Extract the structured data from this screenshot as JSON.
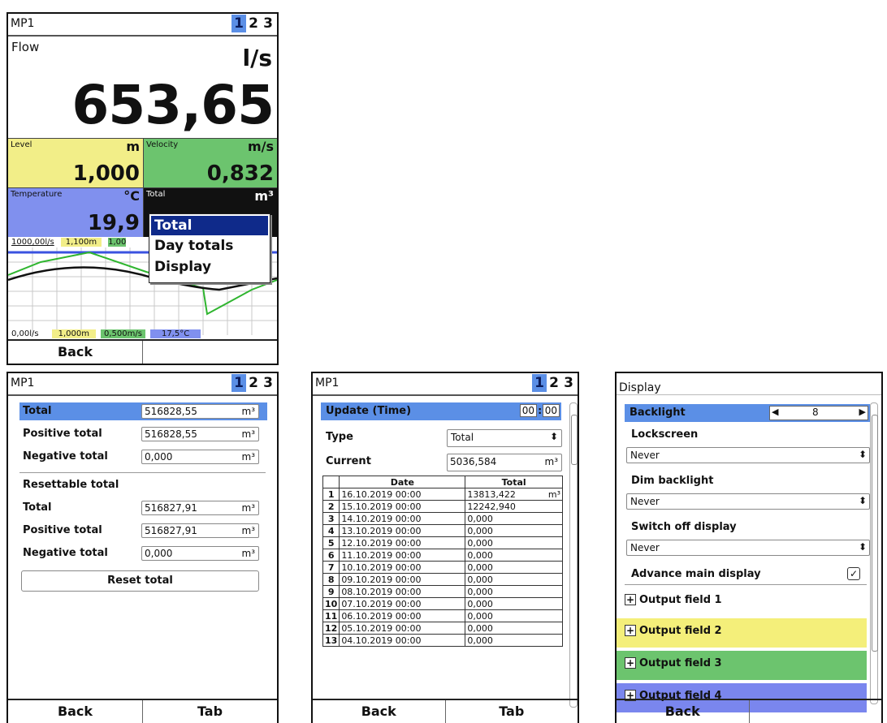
{
  "screen1": {
    "title": "MP1",
    "pages": [
      "1",
      "2",
      "3"
    ],
    "main": {
      "label": "Flow",
      "unit": "l/s",
      "value": "653,65"
    },
    "level": {
      "label": "Level",
      "unit": "m",
      "value": "1,000",
      "color": "#f2ee88"
    },
    "velocity": {
      "label": "Velocity",
      "unit": "m/s",
      "value": "0,832",
      "color": "#6cc46e"
    },
    "temperature": {
      "label": "Temperature",
      "unit": "°C",
      "value": "19,9",
      "color": "#8090ee"
    },
    "total": {
      "label": "Total",
      "unit": "m³"
    },
    "popup": {
      "items": [
        "Total",
        "Day totals",
        "Display"
      ],
      "selected": 0
    },
    "graph": {
      "top_labels": [
        "1000,00l/s",
        "1,100m",
        "1,00"
      ],
      "bottom_labels": [
        "0,00l/s",
        "1,000m",
        "0,500m/s",
        "17,5°C"
      ]
    },
    "softkeys": [
      "Back",
      ""
    ]
  },
  "screen2": {
    "title": "MP1",
    "pages": [
      "1",
      "2",
      "3"
    ],
    "rows": [
      {
        "label": "Total",
        "value": "516828,55",
        "unit": "m³",
        "selected": true
      },
      {
        "label": "Positive total",
        "value": "516828,55",
        "unit": "m³"
      },
      {
        "label": "Negative total",
        "value": "0,000",
        "unit": "m³"
      }
    ],
    "resettable_heading": "Resettable total",
    "reset_rows": [
      {
        "label": "Total",
        "value": "516827,91",
        "unit": "m³"
      },
      {
        "label": "Positive total",
        "value": "516827,91",
        "unit": "m³"
      },
      {
        "label": "Negative total",
        "value": "0,000",
        "unit": "m³"
      }
    ],
    "reset_button": "Reset total",
    "softkeys": [
      "Back",
      "Tab"
    ]
  },
  "screen3": {
    "title": "MP1",
    "pages": [
      "1",
      "2",
      "3"
    ],
    "update_label": "Update (Time)",
    "update_hh": "00",
    "update_mm": "00",
    "type_label": "Type",
    "type_value": "Total",
    "current_label": "Current",
    "current_value": "5036,584",
    "current_unit": "m³",
    "table": {
      "headers": [
        "",
        "Date",
        "Total"
      ],
      "unit": "m³",
      "rows": [
        [
          "1",
          "16.10.2019 00:00",
          "13813,422"
        ],
        [
          "2",
          "15.10.2019 00:00",
          "12242,940"
        ],
        [
          "3",
          "14.10.2019 00:00",
          "0,000"
        ],
        [
          "4",
          "13.10.2019 00:00",
          "0,000"
        ],
        [
          "5",
          "12.10.2019 00:00",
          "0,000"
        ],
        [
          "6",
          "11.10.2019 00:00",
          "0,000"
        ],
        [
          "7",
          "10.10.2019 00:00",
          "0,000"
        ],
        [
          "8",
          "09.10.2019 00:00",
          "0,000"
        ],
        [
          "9",
          "08.10.2019 00:00",
          "0,000"
        ],
        [
          "10",
          "07.10.2019 00:00",
          "0,000"
        ],
        [
          "11",
          "06.10.2019 00:00",
          "0,000"
        ],
        [
          "12",
          "05.10.2019 00:00",
          "0,000"
        ],
        [
          "13",
          "04.10.2019 00:00",
          "0,000"
        ]
      ]
    },
    "softkeys": [
      "Back",
      "Tab"
    ]
  },
  "screen4": {
    "title": "Display",
    "backlight_label": "Backlight",
    "backlight_value": "8",
    "lockscreen_label": "Lockscreen",
    "lockscreen_value": "Never",
    "dim_label": "Dim backlight",
    "dim_value": "Never",
    "switch_label": "Switch off display",
    "switch_value": "Never",
    "advance_label": "Advance main display",
    "advance_checked": true,
    "output_fields": [
      {
        "label": "Output field 1",
        "color": "#ffffff"
      },
      {
        "label": "Output field 2",
        "color": "#f4ef7a"
      },
      {
        "label": "Output field 3",
        "color": "#6cc46e"
      },
      {
        "label": "Output field 4",
        "color": "#7a86ee"
      }
    ],
    "softkeys": [
      "Back",
      ""
    ]
  }
}
